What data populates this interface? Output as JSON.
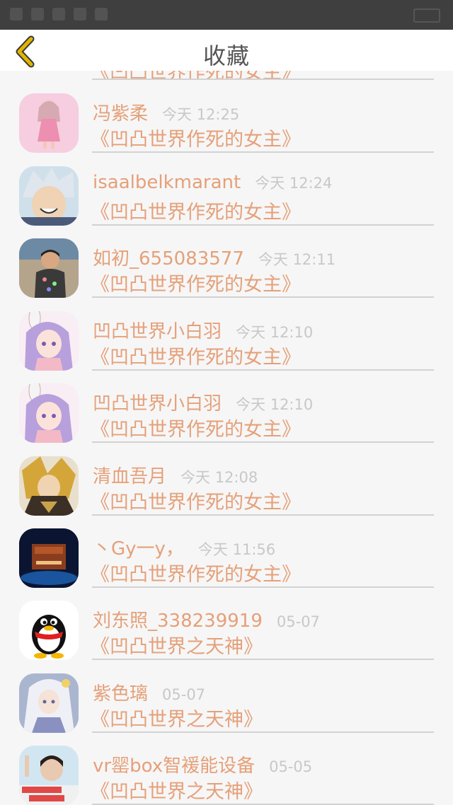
{
  "page": {
    "title": "收藏"
  },
  "colors": {
    "accent": "#e5a079",
    "back_icon": "#e1b400",
    "meta": "#c8c8c8"
  },
  "items": [
    {
      "user": "",
      "time": "",
      "book": "《凹凸世界作死的女主》",
      "avatar": "dark-art-avatar"
    },
    {
      "user": "冯紫柔",
      "time": "今天 12:25",
      "book": "《凹凸世界作死的女主》",
      "avatar": "pink-girl-avatar"
    },
    {
      "user": "isaalbelkmarant",
      "time": "今天 12:24",
      "book": "《凹凸世界作死的女主》",
      "avatar": "silver-hair-avatar"
    },
    {
      "user": "如初_655083577",
      "time": "今天 12:11",
      "book": "《凹凸世界作死的女主》",
      "avatar": "child-photo-avatar"
    },
    {
      "user": "凹凸世界小白羽",
      "time": "今天 12:10",
      "book": "《凹凸世界作死的女主》",
      "avatar": "purple-hair-avatar"
    },
    {
      "user": "凹凸世界小白羽",
      "time": "今天 12:10",
      "book": "《凹凸世界作死的女主》",
      "avatar": "purple-hair-avatar"
    },
    {
      "user": "清血吾月",
      "time": "今天 12:08",
      "book": "《凹凸世界作死的女主》",
      "avatar": "blonde-warrior-avatar"
    },
    {
      "user": "丶Gy一y，",
      "time": "今天 11:56",
      "book": "《凹凸世界作死的女主》",
      "avatar": "game-screen-avatar"
    },
    {
      "user": "刘东照_338239919",
      "time": "05-07",
      "book": "《凹凸世界之天神》",
      "avatar": "qq-penguin-avatar"
    },
    {
      "user": "紫色璃",
      "time": "05-07",
      "book": "《凹凸世界之天神》",
      "avatar": "white-hair-avatar"
    },
    {
      "user": "vr罂box智褑能设备",
      "time": "05-05",
      "book": "《凹凸世界之天神》",
      "avatar": "girl-photo-avatar"
    }
  ]
}
